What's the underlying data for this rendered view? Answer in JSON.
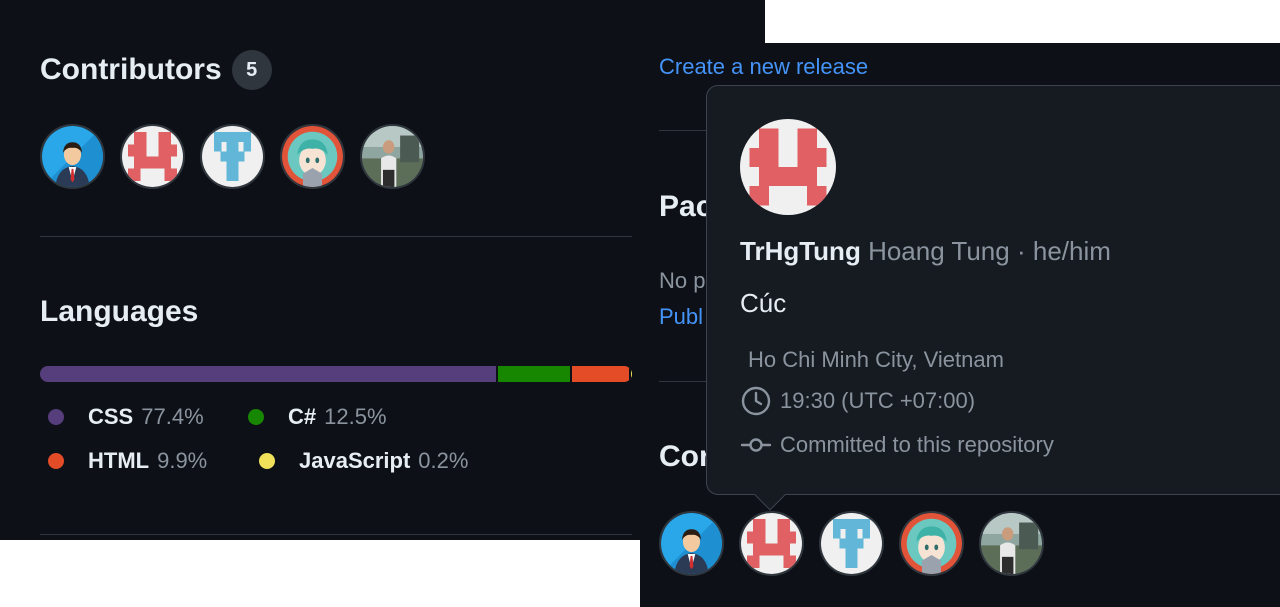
{
  "contributors": {
    "title": "Contributors",
    "count": "5",
    "avatars": [
      "avatar-business-person",
      "avatar-pixel-red",
      "avatar-pixel-blue",
      "avatar-anime",
      "avatar-photo"
    ]
  },
  "languages": {
    "title": "Languages",
    "items": [
      {
        "name": "CSS",
        "percent": "77.4%",
        "value": 77.4,
        "color": "#563d7c"
      },
      {
        "name": "C#",
        "percent": "12.5%",
        "value": 12.5,
        "color": "#178600"
      },
      {
        "name": "HTML",
        "percent": "9.9%",
        "value": 9.9,
        "color": "#e34c26"
      },
      {
        "name": "JavaScript",
        "percent": "0.2%",
        "value": 0.2,
        "color": "#f1e05a"
      }
    ]
  },
  "releases": {
    "link": "Create a new release"
  },
  "packages": {
    "title_partial": "Pac",
    "empty_partial": "No p",
    "link_partial": "Publ"
  },
  "contributors_right": {
    "title_partial": "Cor"
  },
  "hovercard": {
    "login": "TrHgTung",
    "fullname": "Hoang Tung",
    "separator": "·",
    "pronouns": "he/him",
    "bio": "Cúc",
    "location": "Ho Chi Minh City, Vietnam",
    "time": "19:30 (UTC +07:00)",
    "committed": "Committed to this repository"
  },
  "colors": {
    "background": "#0d1117",
    "card": "#161b22",
    "link": "#4493f8",
    "muted": "#8b949e"
  }
}
